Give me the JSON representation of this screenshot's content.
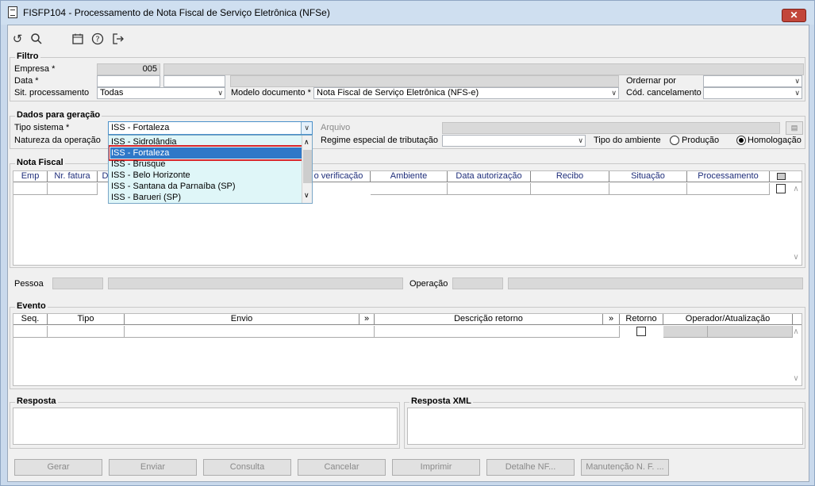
{
  "window": {
    "title": "FISFP104 - Processamento de Nota Fiscal de Serviço Eletrônica (NFSe)",
    "close_label": "✕"
  },
  "toolbar": {
    "icons": [
      "refresh-icon",
      "search-icon",
      "calendar-icon",
      "help-icon",
      "exit-icon"
    ]
  },
  "filtro": {
    "title": "Filtro",
    "empresa_label": "Empresa *",
    "empresa_value": "005",
    "data_label": "Data *",
    "sit_label": "Sit. processamento",
    "sit_value": "Todas",
    "modelo_label": "Modelo documento *",
    "modelo_value": "Nota Fiscal de Serviço Eletrônica (NFS-e)",
    "ordenar_label": "Ordernar por",
    "cod_cancel_label": "Cód. cancelamento"
  },
  "dados": {
    "title": "Dados para geração",
    "tipo_sistema_label": "Tipo sistema *",
    "tipo_sistema_value": "ISS - Fortaleza",
    "natureza_label": "Natureza da operação",
    "arquivo_label": "Arquivo",
    "regime_label": "Regime especial de tributação",
    "tipo_ambiente_label": "Tipo do ambiente",
    "producao_label": "Produção",
    "homologacao_label": "Homologação",
    "dropdown_items": [
      "ISS - Sidrolândia",
      "ISS - Fortaleza",
      "ISS - Brusque",
      "ISS - Belo Horizonte",
      "ISS - Santana da Parnaíba (SP)",
      "ISS - Barueri (SP)"
    ],
    "selected_index": 1
  },
  "nota_fiscal": {
    "title": "Nota Fiscal",
    "columns": [
      "Emp",
      "Nr. fatura",
      "D",
      "o verificação",
      "Ambiente",
      "Data autorização",
      "Recibo",
      "Situação",
      "Processamento"
    ],
    "pessoa_label": "Pessoa",
    "operacao_label": "Operação"
  },
  "evento": {
    "title": "Evento",
    "columns": [
      "Seq.",
      "Tipo",
      "Envio",
      "»",
      "Descrição retorno",
      "»",
      "Retorno",
      "Operador/Atualização"
    ]
  },
  "resposta": {
    "title": "Resposta"
  },
  "resposta_xml": {
    "title": "Resposta XML"
  },
  "buttons": [
    "Gerar",
    "Enviar",
    "Consulta",
    "Cancelar",
    "Imprimir",
    "Detalhe NF...",
    "Manutenção N. F. ..."
  ]
}
